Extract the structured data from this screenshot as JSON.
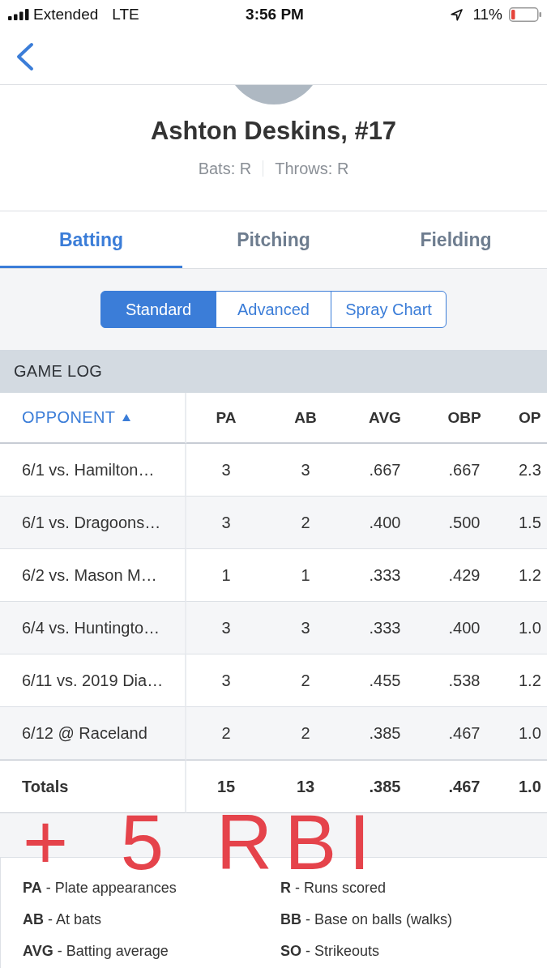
{
  "status_bar": {
    "carrier": "Extended",
    "network": "LTE",
    "time": "3:56 PM",
    "battery": "11%"
  },
  "player": {
    "name": "Ashton Deskins, #17",
    "bats": "Bats: R",
    "throws": "Throws: R"
  },
  "tabs": [
    {
      "label": "Batting",
      "selected": true
    },
    {
      "label": "Pitching",
      "selected": false
    },
    {
      "label": "Fielding",
      "selected": false
    }
  ],
  "segments": [
    {
      "label": "Standard",
      "selected": true
    },
    {
      "label": "Advanced",
      "selected": false
    },
    {
      "label": "Spray Chart",
      "selected": false
    }
  ],
  "game_log": {
    "title": "GAME LOG",
    "columns": [
      {
        "label": "OPPONENT",
        "sorted": true
      },
      {
        "label": "PA",
        "sorted": false
      },
      {
        "label": "AB",
        "sorted": false
      },
      {
        "label": "AVG",
        "sorted": false
      },
      {
        "label": "OBP",
        "sorted": false
      },
      {
        "label": "OP",
        "sorted": false
      }
    ],
    "rows": [
      {
        "opponent": "6/1 vs. Hamilton…",
        "values": [
          "3",
          "3",
          ".667",
          ".667",
          "2.3"
        ]
      },
      {
        "opponent": "6/1 vs. Dragoons…",
        "values": [
          "3",
          "2",
          ".400",
          ".500",
          "1.5"
        ]
      },
      {
        "opponent": "6/2 vs. Mason M…",
        "values": [
          "1",
          "1",
          ".333",
          ".429",
          "1.2"
        ]
      },
      {
        "opponent": "6/4 vs. Huntingto…",
        "values": [
          "3",
          "3",
          ".333",
          ".400",
          "1.0"
        ]
      },
      {
        "opponent": "6/11 vs. 2019 Dia…",
        "values": [
          "3",
          "2",
          ".455",
          ".538",
          "1.2"
        ]
      },
      {
        "opponent": "6/12 @ Raceland",
        "values": [
          "2",
          "2",
          ".385",
          ".467",
          "1.0"
        ]
      }
    ],
    "totals": {
      "label": "Totals",
      "values": [
        "15",
        "13",
        ".385",
        ".467",
        "1.0"
      ]
    }
  },
  "legend": [
    {
      "text": "**PA** - Plate appearances"
    },
    {
      "text": "**R** - Runs scored"
    },
    {
      "text": "**AB** - At bats"
    },
    {
      "text": "**BB** - Base on balls (walks)"
    },
    {
      "text": "**AVG** - Batting average"
    },
    {
      "text": "**SO** - Strikeouts"
    }
  ],
  "handwritten_annotation": "+ 5 RBI"
}
